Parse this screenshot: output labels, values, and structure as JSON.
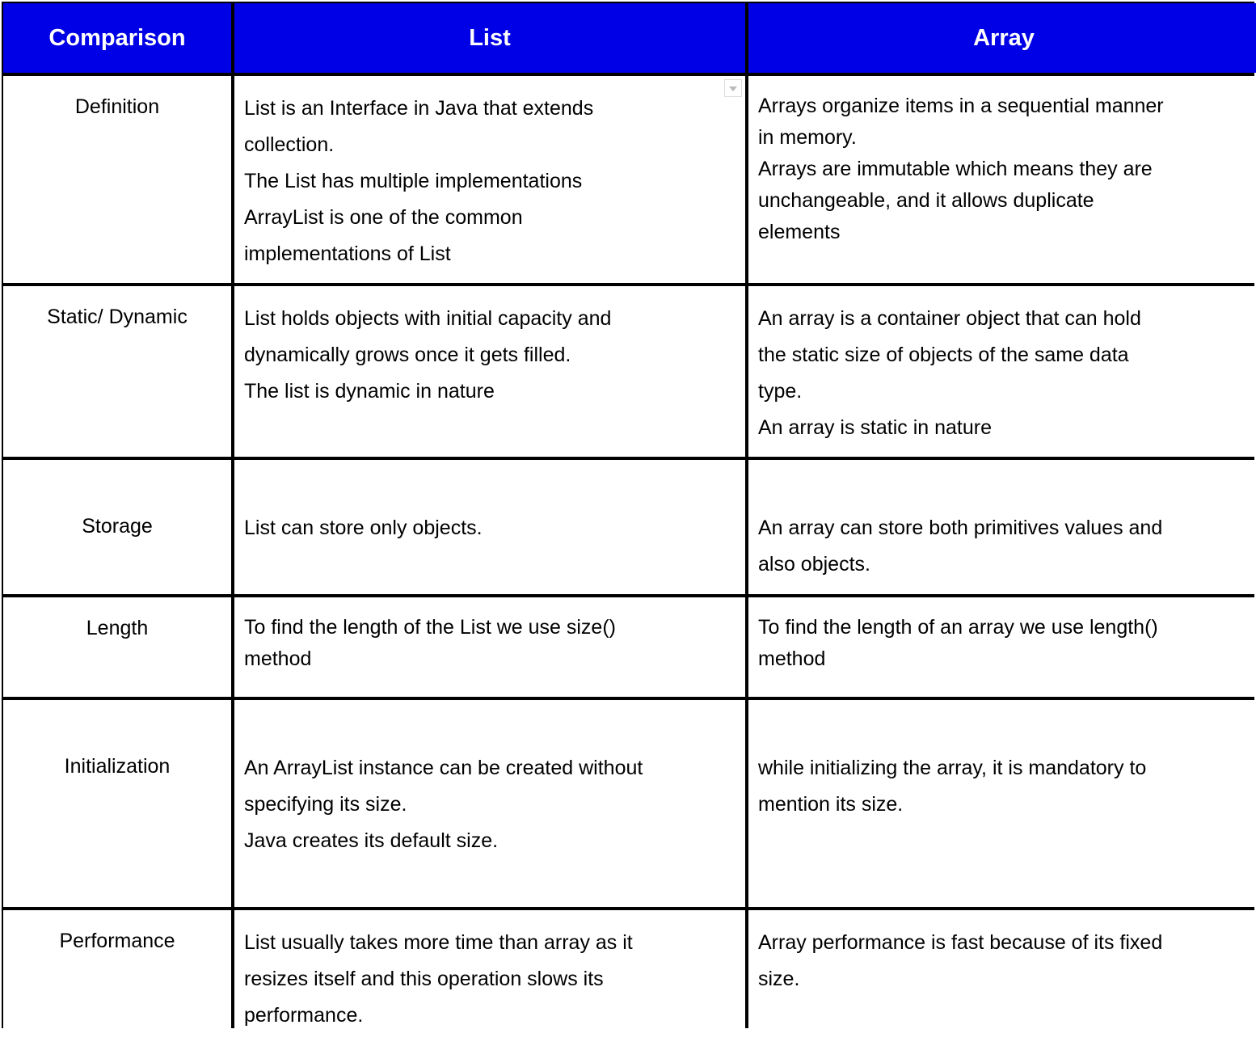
{
  "header": [
    "Comparison",
    "List",
    "Array"
  ],
  "rows": [
    {
      "label": "Definition",
      "list": [
        "List is an Interface in Java that extends",
        "collection.",
        "The List has multiple implementations",
        "ArrayList is one of the common",
        "implementations of List"
      ],
      "array": [
        "Arrays organize items in a sequential manner",
        "in memory.",
        "Arrays are immutable which means they are",
        "unchangeable, and it allows duplicate",
        "elements"
      ]
    },
    {
      "label": "Static/ Dynamic",
      "list": [
        "List holds objects with initial capacity and",
        "dynamically grows once it gets filled.",
        "The list is dynamic in nature"
      ],
      "array": [
        "An array is a container object that can hold",
        "the static size of objects of the same data",
        "type.",
        "An array is static in nature"
      ]
    },
    {
      "label": "Storage",
      "list": [
        "List can store only objects."
      ],
      "array": [
        "An array can store both primitives values and",
        "also objects."
      ]
    },
    {
      "label": "Length",
      "list": [
        "To find the length of the List we use size()",
        "method"
      ],
      "array": [
        "To find the length of an array we use length()",
        "method"
      ]
    },
    {
      "label": "Initialization",
      "list": [
        "An ArrayList instance can be created without",
        "specifying its size.",
        "Java creates its default size."
      ],
      "array": [
        "while initializing the array, it is mandatory to",
        "mention its size."
      ]
    },
    {
      "label": "Performance",
      "list": [
        "List usually takes more time than array as it",
        "resizes itself and this operation slows its",
        "performance."
      ],
      "array": [
        "Array performance is fast because of its fixed",
        "size."
      ]
    }
  ],
  "colors": {
    "header_bg": "#0000e6",
    "header_text": "#ffffff",
    "border": "#000000"
  },
  "icons": {
    "cell_dropdown": "chevron-down-icon"
  }
}
